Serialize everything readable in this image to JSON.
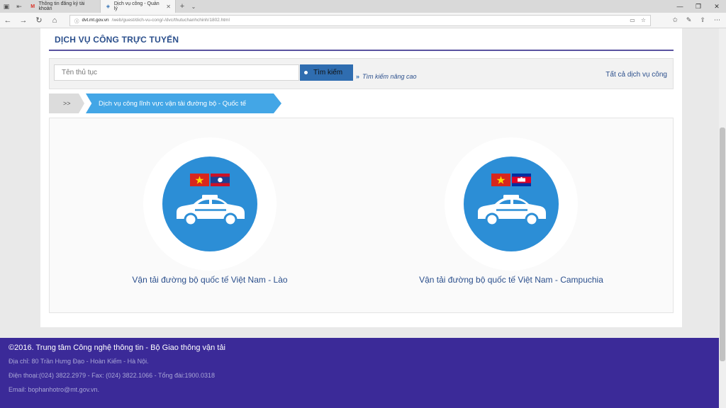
{
  "browser": {
    "tabs": [
      {
        "title": "Thông tin đăng ký tài khoản",
        "active": false,
        "favicon": "gmail-icon"
      },
      {
        "title": "Dịch vụ công - Quản lý",
        "active": true,
        "favicon": "site-icon"
      }
    ],
    "url": {
      "host": "dvt.mt.gov.vn",
      "path": "/web/guest/dich-vu-cong/-/dvc/thutuchanhchinh/1802.html"
    }
  },
  "page": {
    "title": "DỊCH VỤ CÔNG TRỰC TUYẾN",
    "search": {
      "placeholder": "Tên thủ tục",
      "button_label": "Tìm kiếm",
      "advanced_label": "Tìm kiếm nâng cao",
      "all_services_label": "Tất cả dịch vụ công"
    },
    "breadcrumb": {
      "home": ">>",
      "current": "Dịch vụ công lĩnh vực vận tải đường bộ - Quốc tế"
    },
    "cards": [
      {
        "label": "Vận tải đường bộ quốc tế Việt Nam - Lào",
        "flags": [
          "vietnam-flag",
          "laos-flag"
        ],
        "icon": "taxi-icon"
      },
      {
        "label": "Vận tải đường bộ quốc tế Việt Nam - Campuchia",
        "flags": [
          "vietnam-flag",
          "cambodia-flag"
        ],
        "icon": "taxi-icon"
      }
    ]
  },
  "footer": {
    "copyright": "©2016. Trung tâm Công nghệ thông tin - Bộ Giao thông vận tải",
    "address": "Địa chỉ: 80 Trần Hưng Đạo - Hoàn Kiếm - Hà Nội.",
    "phone": "Điện thoại:(024) 3822.2979 - Fax: (024) 3822.1066 - Tổng đài:1900.0318",
    "email": "Email: bophanhotro@mt.gov.vn."
  },
  "colors": {
    "primary": "#2f6db0",
    "disc": "#2c8ed6",
    "footer": "#3b2a98",
    "accent_rule": "#5a53a0"
  }
}
